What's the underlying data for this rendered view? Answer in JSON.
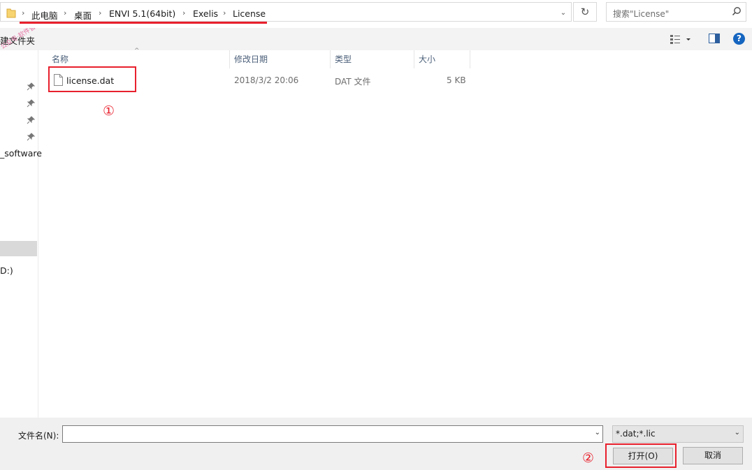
{
  "address": {
    "crumbs": [
      "此电脑",
      "桌面",
      "ENVI 5.1(64bit)",
      "Exelis",
      "License"
    ],
    "separator": "›",
    "dropdown_glyph": "⌄",
    "refresh_glyph": "↻"
  },
  "search": {
    "placeholder": "搜索\"License\""
  },
  "toolbar": {
    "new_folder_label": "建文件夹",
    "help_label": "?"
  },
  "watermark_text": "公众号·软件管家",
  "nav": {
    "items": [
      "_software",
      "D:)"
    ]
  },
  "columns": {
    "name": "名称",
    "modified": "修改日期",
    "type": "类型",
    "size": "大小",
    "sort_glyph": "^"
  },
  "files": [
    {
      "name": "license.dat",
      "modified": "2018/3/2 20:06",
      "type": "DAT 文件",
      "size": "5 KB"
    }
  ],
  "annotations": {
    "step1": "①",
    "step2": "②",
    "color": "#e8202d"
  },
  "bottom": {
    "filename_label": "文件名(N):",
    "filename_value": "",
    "filter_value": "*.dat;*.lic",
    "dropdown_glyph": "⌄",
    "open_label": "打开(O)",
    "cancel_label": "取消"
  },
  "icons": [
    "folder-icon",
    "refresh-icon",
    "search-icon",
    "view-options-icon",
    "preview-pane-icon",
    "help-icon",
    "pin-icon",
    "file-icon"
  ]
}
